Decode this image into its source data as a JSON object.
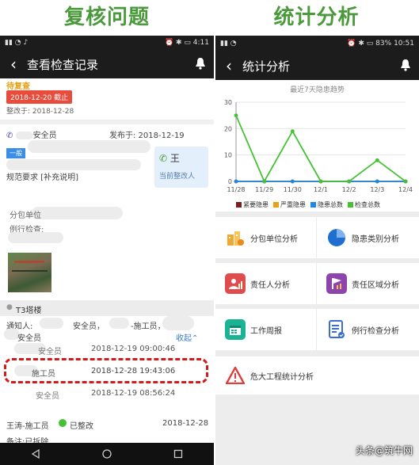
{
  "left_title": "复核问题",
  "right_title": "统计分析",
  "left": {
    "status_time": "4:11",
    "nav_title": "查看检查记录",
    "status_label": "待复查",
    "deadline": "2018-12-20 截止",
    "rectify_date": "整改于: 2018-12-28",
    "inspector": "安全员",
    "publish": "发布于: 2018-12-19",
    "level_badge": "一般",
    "requirement": "规范要求 [补充说明]",
    "assignee_name": "王",
    "assignee_role": "当前整改人",
    "subcontractor": "分包单位",
    "routine": "例行检查:",
    "location": "T3塔楼",
    "notify_label": "通知人:",
    "notify_text": "安全员，",
    "notify_text2": "-施工员，",
    "notify_extra": "安全员",
    "collapse": "收起",
    "logs": [
      {
        "who": "安全员",
        "time": "2018-12-19 09:00:46"
      },
      {
        "who": "施工员",
        "time": "2018-12-28 19:43:06"
      },
      {
        "who": "安全员",
        "time": "2018-12-19 08:56:24"
      }
    ],
    "footer_person": "王涛-施工员",
    "footer_status": "已整改",
    "footer_date": "2018-12-28",
    "footer_note": "备注:已拆除"
  },
  "right": {
    "status_battery": "83%",
    "status_time": "10:51",
    "nav_title": "统计分析",
    "chart_title": "最近7天隐患趋势",
    "menu": [
      {
        "label": "分包单位分析",
        "icon": "building-chart-icon"
      },
      {
        "label": "隐患类别分析",
        "icon": "pie-chart-icon"
      },
      {
        "label": "责任人分析",
        "icon": "person-chart-icon"
      },
      {
        "label": "责任区域分析",
        "icon": "flag-chart-icon"
      },
      {
        "label": "工作周报",
        "icon": "calendar-icon"
      },
      {
        "label": "例行检查分析",
        "icon": "checklist-icon"
      },
      {
        "label": "危大工程统计分析",
        "icon": "warning-icon"
      }
    ]
  },
  "watermark": "头条@筑牛网",
  "colors": {
    "green": "#44c233",
    "red": "#c00000",
    "orange": "#e6a117",
    "blue": "#1e88e5",
    "brown": "#7b1e1e"
  },
  "chart_data": {
    "type": "line",
    "title": "最近7天隐患趋势",
    "categories": [
      "11/28",
      "11/29",
      "11/30",
      "12/1",
      "12/2",
      "12/3",
      "12/4"
    ],
    "ylim": [
      0,
      30
    ],
    "yticks": [
      0,
      10,
      20,
      30
    ],
    "series": [
      {
        "name": "紧要隐患",
        "color": "#7b1e1e",
        "values": [
          0,
          0,
          0,
          0,
          0,
          0,
          0
        ]
      },
      {
        "name": "严重隐患",
        "color": "#e6a117",
        "values": [
          0,
          0,
          0,
          0,
          0,
          0,
          0
        ]
      },
      {
        "name": "隐患总数",
        "color": "#1e88e5",
        "values": [
          0,
          0,
          0,
          0,
          0,
          0,
          0
        ]
      },
      {
        "name": "检查总数",
        "color": "#44c233",
        "values": [
          25,
          0,
          19,
          0,
          0,
          8,
          0
        ]
      }
    ]
  }
}
